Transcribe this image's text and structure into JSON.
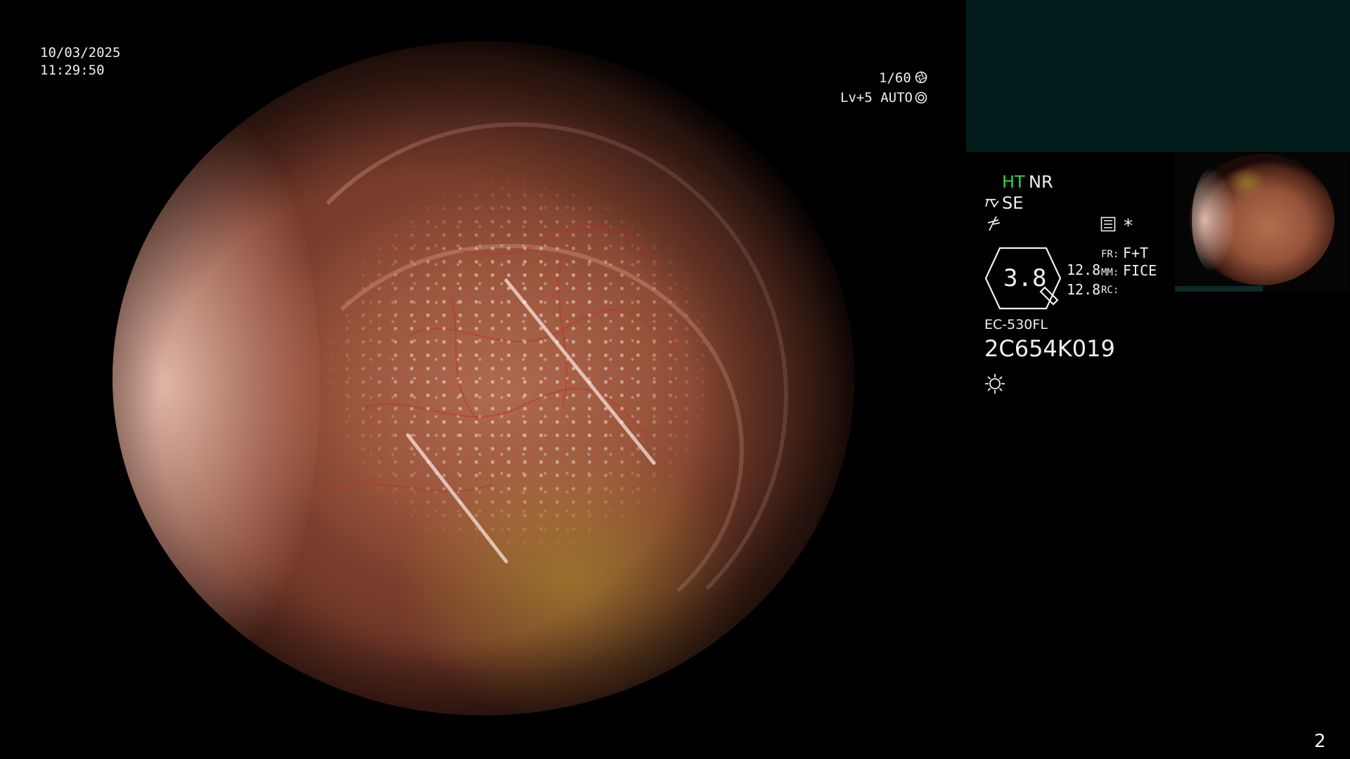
{
  "datetime": {
    "date": "10/03/2025",
    "time": "11:29:50"
  },
  "exposure": {
    "shutter": "1/60",
    "shutter_icon": "aperture-icon",
    "level": "Lv+5 AUTO",
    "level_icon": "iris-icon"
  },
  "modes": {
    "ht": "HT",
    "nr": "NR",
    "se": "SE",
    "se_icon": "structure-enhancement-icon",
    "color_icon": "color-tone-icon",
    "settings_icon": "menu-icon",
    "asterisk": "*"
  },
  "gauge": {
    "value": "3.8",
    "sub_value_1": "12.8",
    "sub_value_2": "12.8"
  },
  "settings": {
    "fr_label": "FR:",
    "fr_value": "F+T",
    "mm_label": "MM:",
    "mm_value": "FICE",
    "rc_label": "RC:",
    "rc_value": ""
  },
  "scope": {
    "model": "EC-530FL",
    "serial": "2C654K019",
    "light_icon": "light-source-icon"
  },
  "page_number": "2",
  "colors": {
    "background": "#000000",
    "panel": "#011c1a",
    "ht_green": "#3cd23c",
    "text": "#f0f0f0"
  }
}
